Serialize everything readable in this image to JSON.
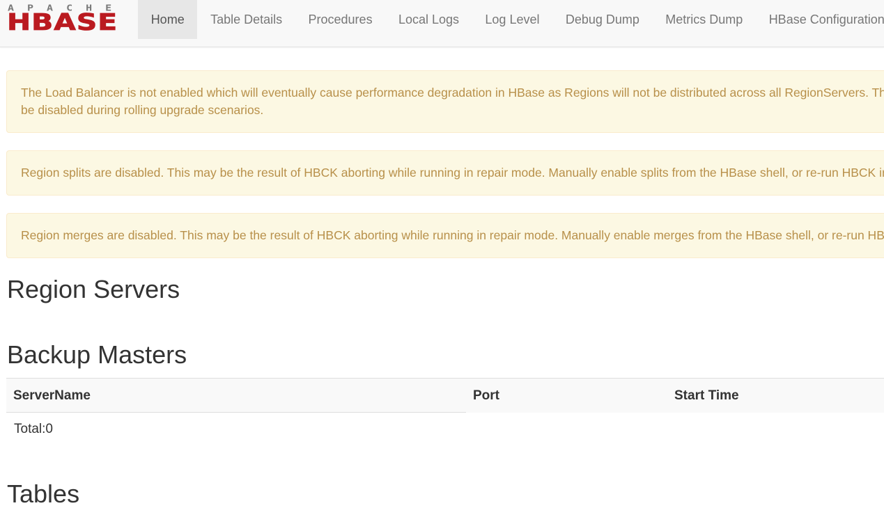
{
  "brand": {
    "top_text": "APACHE",
    "main_text": "HBASE",
    "color": "#ba1a20"
  },
  "nav": {
    "items": [
      {
        "label": "Home",
        "active": true
      },
      {
        "label": "Table Details",
        "active": false
      },
      {
        "label": "Procedures",
        "active": false
      },
      {
        "label": "Local Logs",
        "active": false
      },
      {
        "label": "Log Level",
        "active": false
      },
      {
        "label": "Debug Dump",
        "active": false
      },
      {
        "label": "Metrics Dump",
        "active": false
      },
      {
        "label": "HBase Configuration",
        "active": false
      }
    ]
  },
  "alerts": [
    {
      "line1": "The Load Balancer is not enabled which will eventually cause performance degradation in HBase as Regions will not be distributed across all RegionServers. Th",
      "line2": "be disabled during rolling upgrade scenarios."
    },
    {
      "line1": "Region splits are disabled. This may be the result of HBCK aborting while running in repair mode. Manually enable splits from the HBase shell, or re-run HBCK ir"
    },
    {
      "line1": "Region merges are disabled. This may be the result of HBCK aborting while running in repair mode. Manually enable merges from the HBase shell, or re-run HB"
    }
  ],
  "sections": {
    "region_servers": "Region Servers",
    "backup_masters": "Backup Masters",
    "tables": "Tables"
  },
  "backup_table": {
    "columns": [
      "ServerName",
      "Port",
      "Start Time"
    ],
    "total": "Total:0"
  },
  "colors": {
    "alert_bg": "#fcf8e3",
    "alert_border": "#faebcc",
    "alert_text": "#b8904a",
    "nav_bg": "#f8f8f8",
    "nav_active_bg": "#e7e7e7"
  }
}
